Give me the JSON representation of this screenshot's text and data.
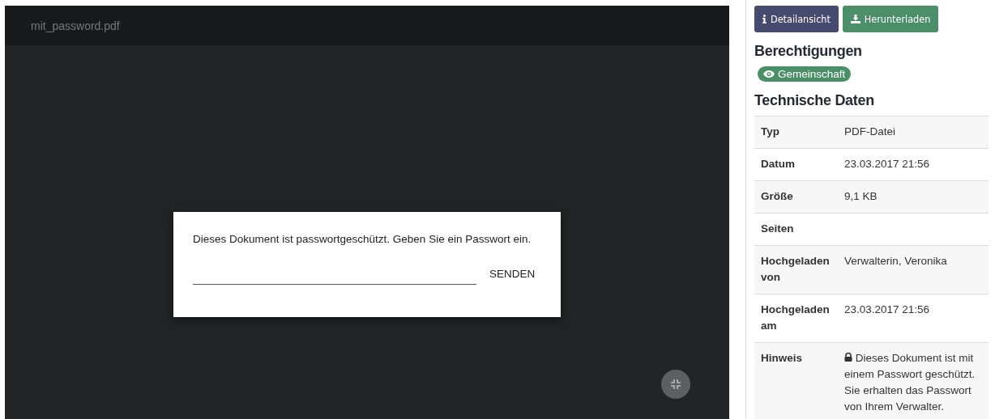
{
  "viewer": {
    "filename": "mit_password.pdf",
    "dialog": {
      "message": "Dieses Dokument ist passwortgeschützt. Geben Sie ein Passwort ein.",
      "submit": "SENDEN"
    }
  },
  "actions": [
    {
      "label": "Detailansicht",
      "kind": "info"
    },
    {
      "label": "Herunterladen",
      "kind": "download"
    }
  ],
  "permissions": {
    "title": "Berechtigungen",
    "badges": [
      "Gemeinschaft"
    ]
  },
  "technical": {
    "title": "Technische Daten",
    "rows": [
      {
        "label": "Typ",
        "value": "PDF-Datei",
        "kind": "plain"
      },
      {
        "label": "Datum",
        "value": "23.03.2017 21:56",
        "kind": "plain"
      },
      {
        "label": "Größe",
        "value": "9,1 KB",
        "kind": "plain"
      },
      {
        "label": "Seiten",
        "value": "",
        "kind": "plain"
      },
      {
        "label": "Hochgeladen von",
        "value": "Verwalterin, Veronika",
        "kind": "plain"
      },
      {
        "label": "Hochgeladen am",
        "value": "23.03.2017 21:56",
        "kind": "plain"
      },
      {
        "label": "Hinweis",
        "value": "Dieses Dokument ist mit einem Passwort geschützt. Sie erhalten das Passwort von Ihrem Verwalter.",
        "kind": "locked"
      }
    ]
  }
}
